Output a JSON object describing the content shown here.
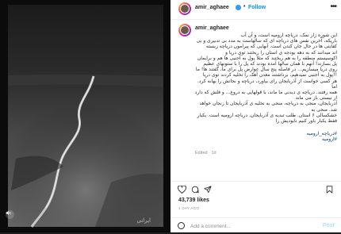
{
  "post": {
    "username": "amir_aghaee",
    "follow_label": "Follow",
    "separator": "•",
    "more_icon": "more-icon",
    "caption": "این شوره زار نمک، دریاچه ارومیه است، و آن آب\nباریکه، آخرین نفس های دریاچه ای که سالهاست به مدد بی تدبیری و بی\nکفایتی ها در حال جان کندن است. آنهایی که پیرامون دریاچه زیسته\nاند میدانند که به دهه بودجه ی استان را ریختند توی دریا و\nاکوسیستم منطقه را به هم ریختند که مثلا پول به آجنبی ها هم و برایمان\nپل بسازند! آنهم با همان سالها آمده بودند که پل را با ستونهای عظیم\nروی دریا میسازیم... در فاصله پنج سال عوارض پل برای ما، گفتند ها! ما\n!!پول به آجنبی نمیدهیم، برداشتند معدن آهک را تخلیه کردند توی دریا\nهر کسی خواست از آذربایجان رای بیاورد، دریاچه و نجاتش را بهانه کرد. اما\nهمه رفتند. دریاچه ی دیدنی ما ماند، با قولهایی به دروغ... و فلش که دارد\nاز نیستی باز می ماند\nآذربایجان، منجی به دریاچه، منجی به تخلیه ی آذربایجان تا زنجان خواهد شد. منجی به\nخشکسالی ۶ استان. طلب تبدیه ی آذربایجان. دریاچه ارومیه است. یکبار\nفقط یکبار باور کنیم نابودیش را",
    "hashtags": [
      "#دریاچه_ارومیه",
      "#ارومیه"
    ],
    "edited_label": "Edited · 1d",
    "likes": "43,739 likes",
    "date": "1 DAY AGO",
    "comment_placeholder": "Add a comment...",
    "post_label": "Post",
    "photo_signature": "ایرانی"
  },
  "colors": {
    "link": "#0095f6",
    "hashtag": "#00376b",
    "verified": "#3897f0"
  }
}
